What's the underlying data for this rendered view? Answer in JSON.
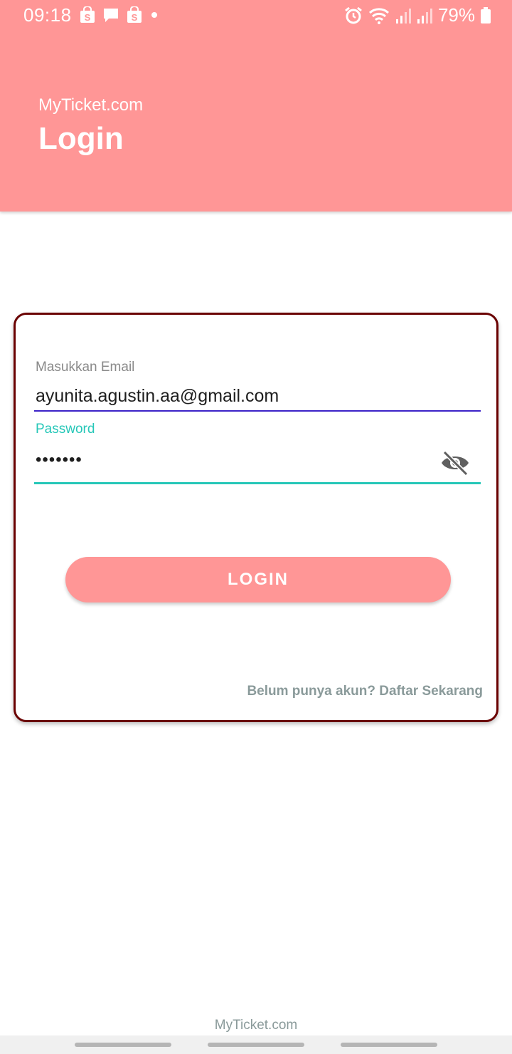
{
  "statusbar": {
    "time": "09:18",
    "battery": "79%",
    "left_icons": [
      "shopee-bag-icon",
      "chat-icon",
      "shopee-bag-icon",
      "dot-icon"
    ],
    "right_icons": [
      "alarm-icon",
      "wifi-icon",
      "signal-icon",
      "signal-icon",
      "battery-icon"
    ]
  },
  "header": {
    "app_name": "MyTicket.com",
    "title": "Login",
    "color": "#ff9696"
  },
  "form": {
    "email_label": "Masukkan Email",
    "email_value": "ayunita.agustin.aa@gmail.com",
    "password_label": "Password",
    "password_value": "•••••••",
    "password_toggle_icon": "eye-off-icon",
    "login_label": "LOGIN",
    "register_text": "Belum punya akun? Daftar Sekarang"
  },
  "footer": {
    "text": "MyTicket.com"
  },
  "colors": {
    "accent": "#ff9696",
    "card_border": "#6a0000",
    "focus_teal": "#26c7b8",
    "email_underline": "#3b22c8"
  }
}
